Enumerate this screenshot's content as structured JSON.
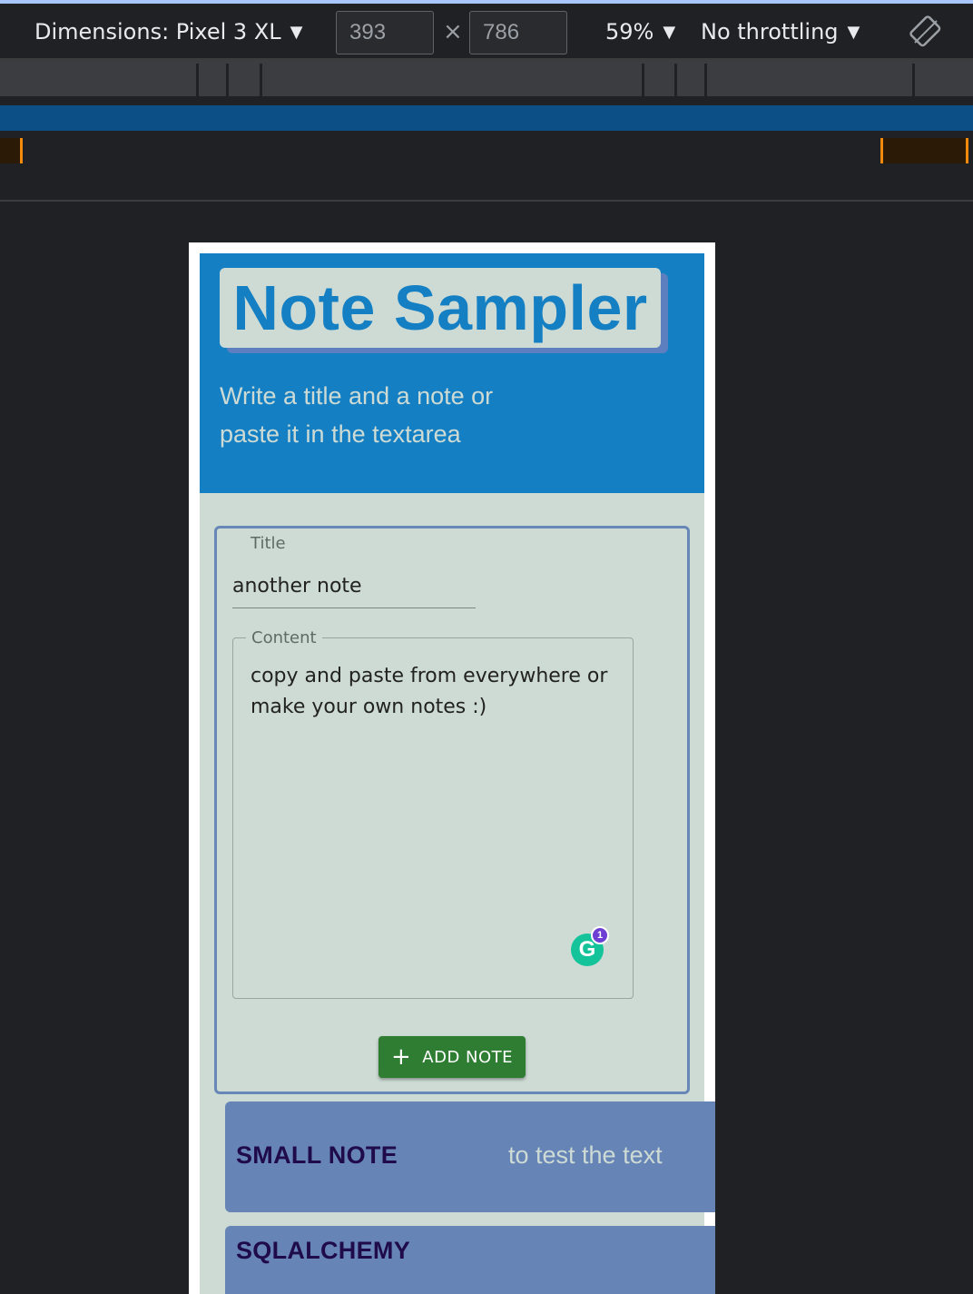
{
  "devtools": {
    "dimensions_label": "Dimensions: Pixel 3 XL",
    "width": "393",
    "times": "×",
    "height": "786",
    "zoom": "59%",
    "throttling": "No throttling",
    "caret": "▼"
  },
  "app": {
    "title": "Note Sampler",
    "subtitle": "Write a title and a note or paste it in the textarea"
  },
  "form": {
    "title_label": "Title",
    "title_value": "another note",
    "content_label": "Content",
    "content_value": "copy and paste from everywhere or make your own notes :)",
    "grammarly_glyph": "G",
    "grammarly_count": "1",
    "add_button_plus": "+",
    "add_button_label": "ADD NOTE"
  },
  "notes": [
    {
      "title": "SMALL NOTE",
      "content": "to test the text"
    },
    {
      "title": "SQLALCHEMY",
      "content": ""
    }
  ],
  "colors": {
    "header_blue": "#157fc4",
    "body_bg": "#cddbd4",
    "note_card": "#6784b7",
    "button_green": "#2e7d32"
  }
}
